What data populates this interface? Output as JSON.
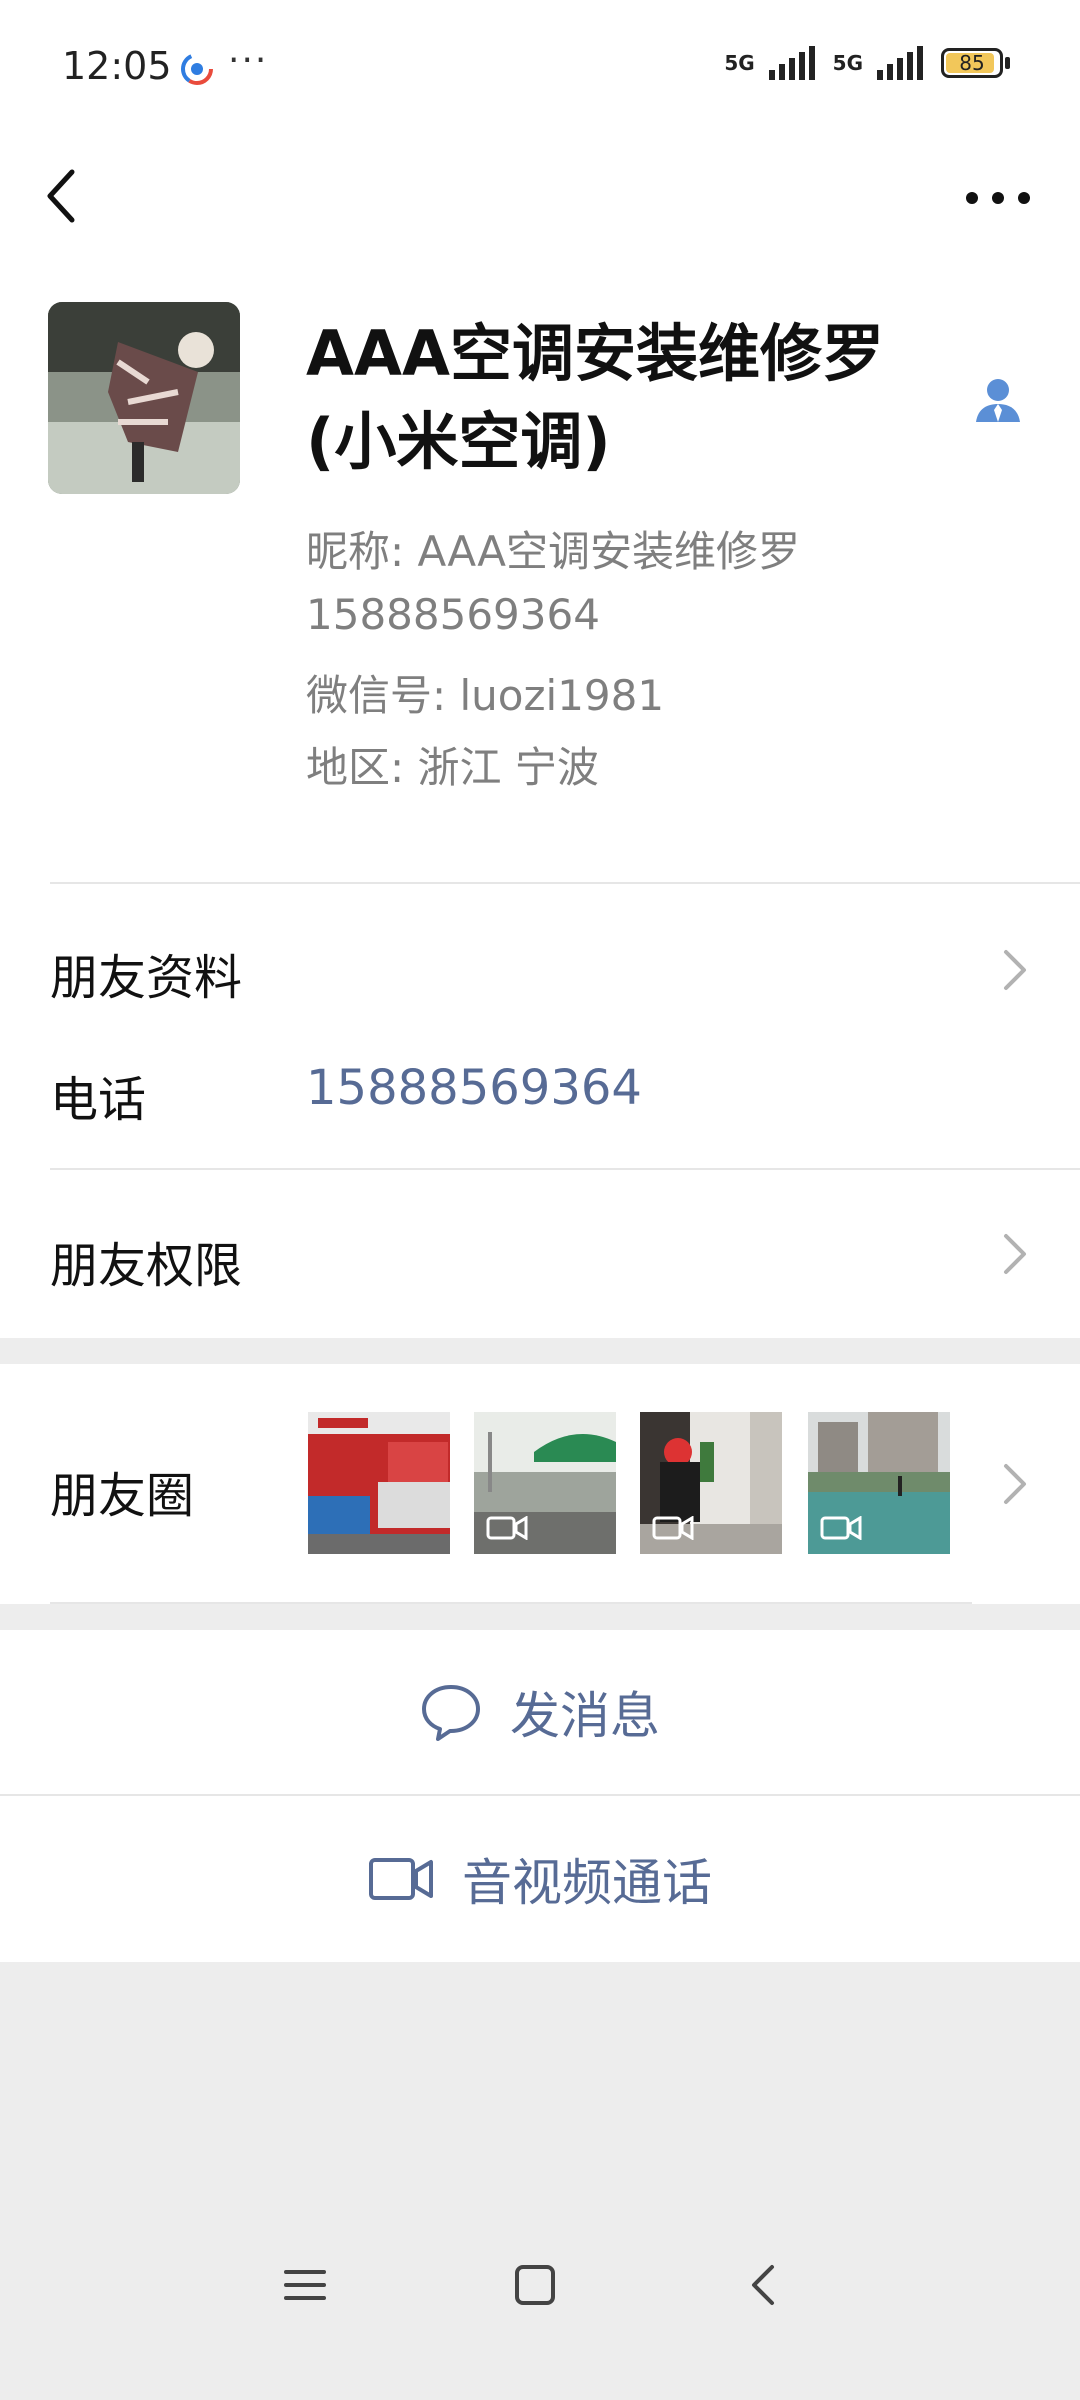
{
  "status_bar": {
    "time": "12:05",
    "more": "···",
    "network_1": "5G",
    "network_2": "5G",
    "battery": "85"
  },
  "profile": {
    "remark_name": "AAA空调安装维修罗(小米空调)",
    "nickname": "昵称:  AAA空调安装维修罗",
    "phone_line": "15888569364",
    "wechat_id": "微信号:  luozi1981",
    "region": "地区:  浙江  宁波"
  },
  "rows": {
    "friend_info": "朋友资料",
    "phone_label": "电话",
    "phone_value": "15888569364",
    "permissions": "朋友权限",
    "moments": "朋友圈"
  },
  "actions": {
    "message": "发消息",
    "av_call": "音视频通话"
  },
  "colors": {
    "link": "#576b95",
    "background": "#ededed",
    "battery": "#f2c75a"
  }
}
